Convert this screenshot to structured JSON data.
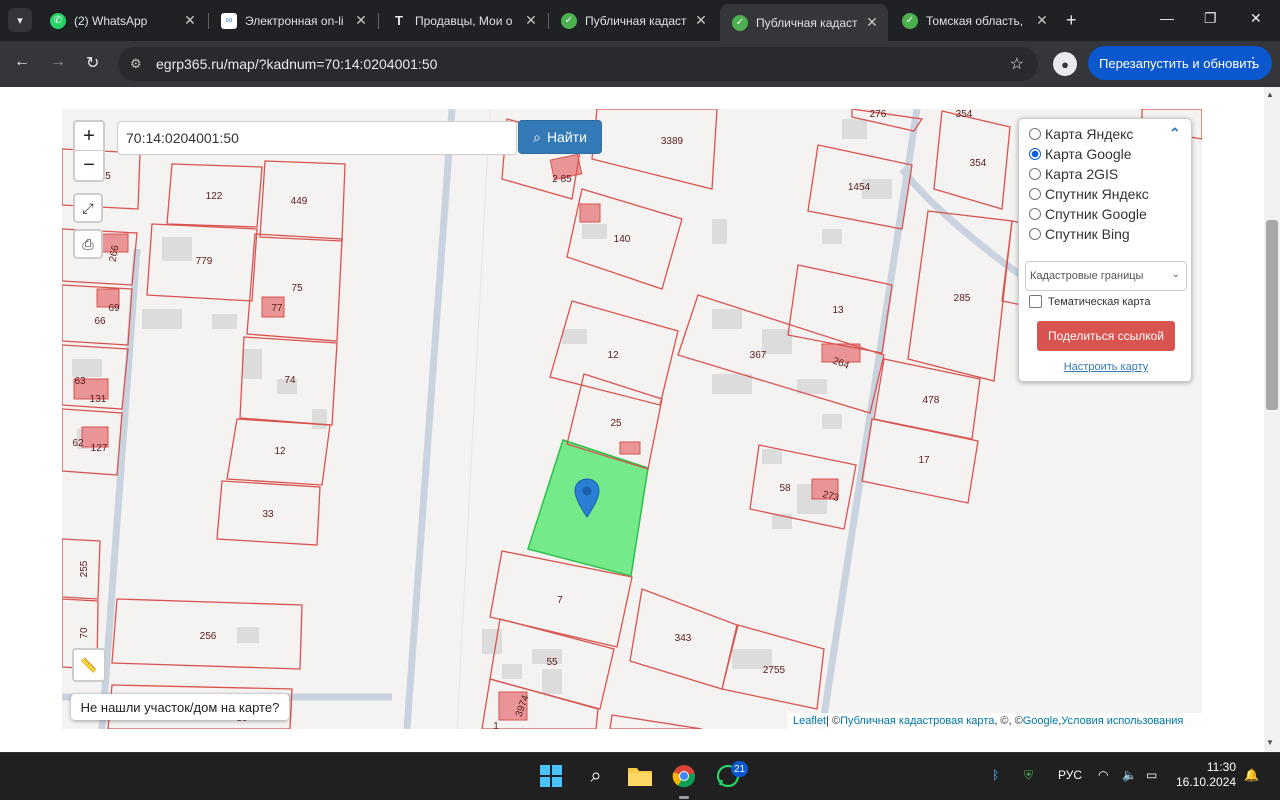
{
  "browser": {
    "tabs": [
      {
        "title": "(2) WhatsApp",
        "icon": "whatsapp-icon",
        "color": "#25d366"
      },
      {
        "title": "Электронная on-li",
        "icon": "infinity-icon",
        "color": "#4a7fd6"
      },
      {
        "title": "Продавцы, Мои о",
        "icon": "t-icon",
        "color": "#5f6368"
      },
      {
        "title": "Публичная кадаст",
        "icon": "check-icon",
        "color": "#4caf50"
      },
      {
        "title": "Публичная кадаст",
        "icon": "check-icon",
        "color": "#4caf50"
      },
      {
        "title": "Томская область,",
        "icon": "check-icon",
        "color": "#4caf50"
      }
    ],
    "active_tab": 4,
    "url": "egrp365.ru/map/?kadnum=70:14:0204001:50",
    "relaunch_label": "Перезапустить и обновить"
  },
  "map": {
    "search": {
      "value": "70:14:0204001:50",
      "button_label": "Найти"
    },
    "zoom_in": "+",
    "zoom_out": "−",
    "layers": {
      "options": [
        "Карта Яндекс",
        "Карта Google",
        "Карта 2GIS",
        "Спутник Яндекс",
        "Спутник Google",
        "Спутник Bing"
      ],
      "selected": "Карта Google",
      "select_value": "Кадастровые границы",
      "thematic_label": "Тематическая карта",
      "thematic_checked": false,
      "share_label": "Поделиться ссылкой",
      "config_label": "Настроить карту"
    },
    "not_found_label": "Не нашли участок/дом на карте?",
    "attribution": {
      "leaflet": "Leaflet",
      "sep1": " | © ",
      "pkk": "Публичная кадастровая карта",
      "sep2": ", ©, © ",
      "google": "Google",
      "sep3": ", ",
      "terms": "Условия использования"
    },
    "parcel_labels": [
      "122",
      "449",
      "3389",
      "2 85",
      "140",
      "1454",
      "354",
      "354",
      "276",
      "779",
      "75",
      "77",
      "266",
      "69",
      "66",
      "63",
      "131",
      "62",
      "127",
      "74",
      "12",
      "33",
      "12",
      "25",
      "367",
      "13",
      "264",
      "285",
      "478",
      "17",
      "58",
      "273",
      "7",
      "343",
      "2755",
      "55",
      "3974",
      "1",
      "255",
      "70",
      "256",
      "5",
      "80"
    ],
    "highlight_color": "#5ee878"
  },
  "taskbar": {
    "whatsapp_badge": "21",
    "lang": "РУС",
    "time": "11:30",
    "date": "16.10.2024"
  }
}
